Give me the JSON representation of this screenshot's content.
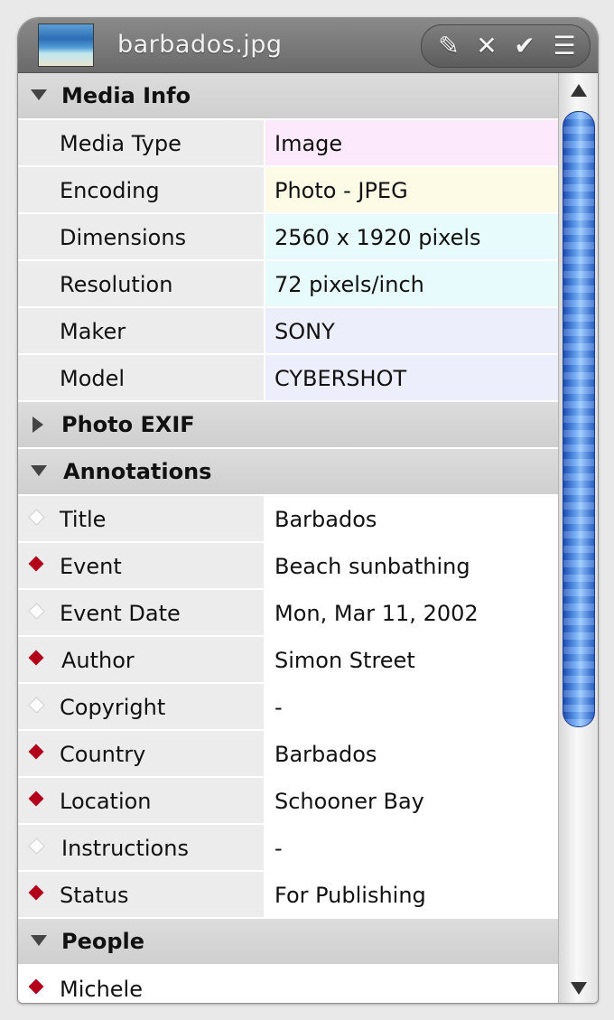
{
  "window": {
    "title": "barbados.jpg",
    "buttons": {
      "edit_icon": "✎",
      "close_icon": "✕",
      "confirm_icon": "✔",
      "list_icon": "☰"
    }
  },
  "colors": {
    "accent_blue": "#3b7be0",
    "required_marker": "#b3001b",
    "row_media_type": "#fce9fb",
    "row_encoding": "#fdfbe6",
    "row_dimensions": "#e7fbfd",
    "row_resolution": "#e7fbfd",
    "row_maker": "#eceefb",
    "row_model": "#eceefb"
  },
  "sections": {
    "media_info": {
      "label": "Media Info",
      "expanded": true,
      "rows": [
        {
          "key": "Media Type",
          "value": "Image"
        },
        {
          "key": "Encoding",
          "value": "Photo - JPEG"
        },
        {
          "key": "Dimensions",
          "value": "2560 x 1920 pixels"
        },
        {
          "key": "Resolution",
          "value": "72 pixels/inch"
        },
        {
          "key": "Maker",
          "value": "SONY"
        },
        {
          "key": "Model",
          "value": "CYBERSHOT"
        }
      ]
    },
    "photo_exif": {
      "label": "Photo EXIF",
      "expanded": false
    },
    "annotations": {
      "label": "Annotations",
      "expanded": true,
      "rows": [
        {
          "key": "Title",
          "value": "Barbados",
          "required": false
        },
        {
          "key": "Event",
          "value": "Beach sunbathing",
          "required": true
        },
        {
          "key": "Event Date",
          "value": "Mon, Mar 11, 2002",
          "required": false
        },
        {
          "key": "Author",
          "value": "Simon Street",
          "required": true
        },
        {
          "key": "Copyright",
          "value": "-",
          "required": false
        },
        {
          "key": "Country",
          "value": "Barbados",
          "required": true
        },
        {
          "key": "Location",
          "value": "Schooner Bay",
          "required": true
        },
        {
          "key": "Instructions",
          "value": "-",
          "required": false
        },
        {
          "key": "Status",
          "value": "For Publishing",
          "required": true
        }
      ]
    },
    "people": {
      "label": "People",
      "expanded": true,
      "rows": [
        {
          "key": "Michele",
          "required": true
        }
      ]
    }
  }
}
